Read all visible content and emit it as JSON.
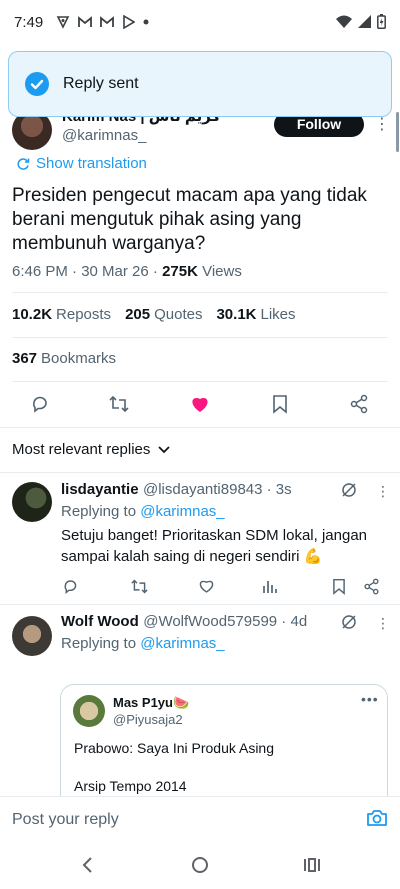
{
  "status_bar": {
    "time": "7:49"
  },
  "toast": {
    "text": "Reply sent"
  },
  "tweet": {
    "author_name": "Karim Nas | كريم ناس",
    "author_handle": "@karimnas_",
    "follow_label": "Follow",
    "show_translation": "Show translation",
    "text": "Presiden pengecut macam apa yang tidak berani mengutuk pihak asing yang membunuh warganya?",
    "meta_time": "6:46 PM · 30 Mar 26 · ",
    "views_count": "275K",
    "views_label": " Views",
    "reposts_count": "10.2K",
    "reposts_label": "Reposts",
    "quotes_count": "205",
    "quotes_label": "Quotes",
    "likes_count": "30.1K",
    "likes_label": "Likes",
    "bookmarks_count": "367",
    "bookmarks_label": "Bookmarks"
  },
  "replies_header": "Most relevant replies",
  "replies": [
    {
      "name": "lisdayantie",
      "handle": "@lisdayanti89843 · 3s",
      "replying_prefix": "Replying to ",
      "replying_to": "@karimnas_",
      "text": "Setuju banget! Prioritaskan SDM lokal, jangan sampai kalah saing di negeri sendiri 💪"
    },
    {
      "name": "Wolf Wood",
      "handle": "@WolfWood579599 · 4d",
      "replying_prefix": "Replying to ",
      "replying_to": "@karimnas_",
      "quote": {
        "name": "Mas P1yu🍉",
        "handle": "@Piyusaja2",
        "line1": "Prabowo: Saya Ini Produk Asing",
        "line2": "Arsip Tempo 2014"
      }
    }
  ],
  "composer": {
    "placeholder": "Post your reply"
  },
  "colors": {
    "accent": "#1d9bf0",
    "like": "#f91880",
    "text": "#0f1419",
    "muted": "#536471"
  }
}
